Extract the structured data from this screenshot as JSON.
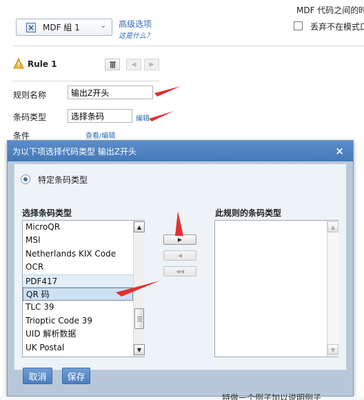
{
  "background": {
    "mdf_group": "MDF 組 1",
    "advanced_link": "高级选项",
    "what_is_this": "这是什么？",
    "mdf_code_text": "MDF 代码之间的时",
    "discard_text": "丢弃不在模式口",
    "rule_title": "Rule 1",
    "rule_name_label": "规则名称",
    "rule_name_value": "输出Z开头",
    "barcode_type_label": "条码类型",
    "barcode_type_value": "选择条码",
    "edit_link": "编辑",
    "condition_label": "条件",
    "view_edit_link": "查看/编辑",
    "bottom_text": "特做一个例子加以说明例子"
  },
  "dialog": {
    "title": "为以下项选择代码类型  输出Z开头",
    "radio_label": "特定条码类型",
    "left_list_title": "选择条码类型",
    "right_list_title": "此规则的条码类型",
    "items": [
      "MicroQR",
      "MSI",
      "Netherlands KIX Code",
      "OCR",
      "PDF417",
      "QR 码",
      "TLC 39",
      "Trioptic Code 39",
      "UID 解析数据",
      "UK Postal"
    ],
    "highlighted_item": "PDF417",
    "selected_item": "QR 码",
    "cancel_label": "取消",
    "save_label": "保存"
  },
  "colors": {
    "header_blue": "#4a7fbe",
    "button_blue": "#5a8ccb",
    "annotation_red": "#e53030",
    "link_blue": "#2f6db5"
  }
}
